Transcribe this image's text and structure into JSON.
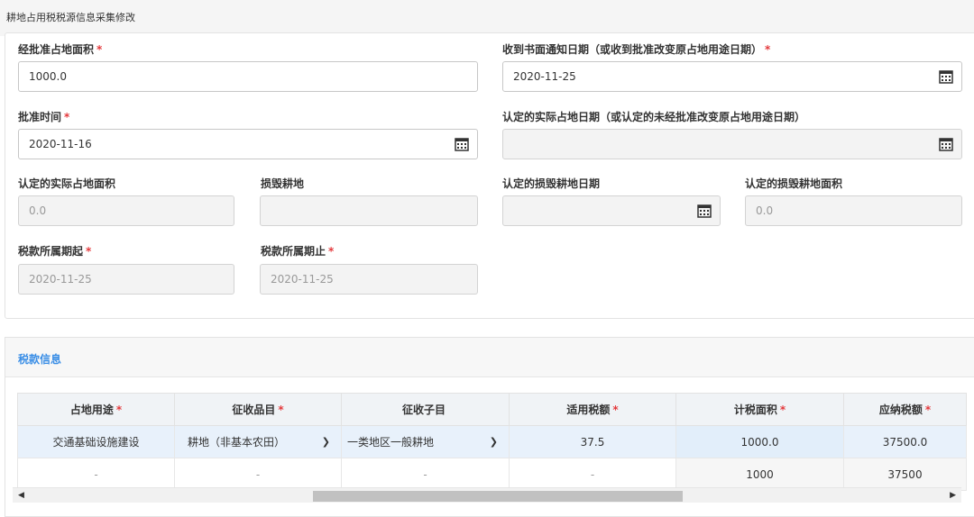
{
  "header": {
    "title": "耕地占用税税源信息采集修改"
  },
  "form": {
    "approved_area": {
      "label": "经批准占地面积",
      "required": "*",
      "value": "1000.0"
    },
    "notice_date": {
      "label": "收到书面通知日期（或收到批准改变原占地用途日期）",
      "required": "*",
      "value": "2020-11-25"
    },
    "approval_time": {
      "label": "批准时间",
      "required": "*",
      "value": "2020-11-16"
    },
    "actual_occupy_date": {
      "label": "认定的实际占地日期（或认定的未经批准改变原占地用途日期）",
      "value": ""
    },
    "actual_area": {
      "label": "认定的实际占地面积",
      "value": "0.0"
    },
    "damaged_land": {
      "label": "损毁耕地",
      "value": ""
    },
    "damaged_date": {
      "label": "认定的损毁耕地日期",
      "value": ""
    },
    "damaged_area": {
      "label": "认定的损毁耕地面积",
      "value": "0.0"
    },
    "period_start": {
      "label": "税款所属期起",
      "required": "*",
      "value": "2020-11-25"
    },
    "period_end": {
      "label": "税款所属期止",
      "required": "*",
      "value": "2020-11-25"
    }
  },
  "tax_section": {
    "title": "税款信息",
    "columns": [
      {
        "label": "占地用途",
        "required": "*"
      },
      {
        "label": "征收品目",
        "required": "*"
      },
      {
        "label": "征收子目",
        "required": ""
      },
      {
        "label": "适用税额",
        "required": "*"
      },
      {
        "label": "计税面积",
        "required": "*"
      },
      {
        "label": "应纳税额",
        "required": "*"
      }
    ],
    "row1": {
      "purpose": "交通基础设施建设",
      "item": "耕地（非基本农田）",
      "subitem": "一类地区一般耕地",
      "rate": "37.5",
      "area": "1000.0",
      "tax": "37500.0"
    },
    "row2": {
      "purpose": "-",
      "item": "-",
      "subitem": "-",
      "rate": "-",
      "area": "1000",
      "tax": "37500"
    }
  },
  "icons": {
    "calendar": "calendar-icon",
    "chevron": "chevron-down-icon"
  }
}
